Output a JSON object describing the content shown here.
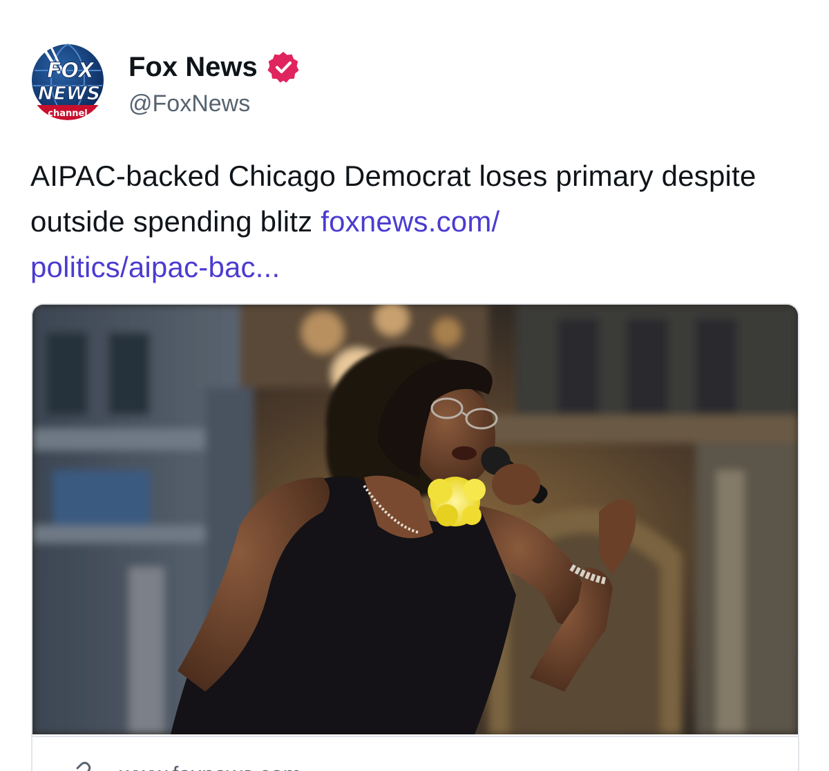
{
  "account": {
    "display_name": "Fox News",
    "handle": "@FoxNews",
    "verified": true,
    "avatar_icon": "fox-news-channel-logo-icon",
    "avatar_text": {
      "line1": "FOX",
      "line2": "NEWS",
      "line3": "channel"
    }
  },
  "post": {
    "text": "AIPAC-backed Chicago Democrat loses primary despite outside spending blitz ",
    "link_text_line1": "foxnews.com/",
    "link_text_line2": "politics/aipac-bac..."
  },
  "card": {
    "image_description_icon": "photo-woman-singing-into-microphone",
    "domain": "www.foxnews.com",
    "link_icon": "link-icon"
  },
  "colors": {
    "link": "#4b3bd1",
    "verified_badge": "#e0245e",
    "handle": "#566370",
    "text": "#0f1419",
    "fox_blue": "#003366",
    "fox_red": "#c8102e"
  }
}
